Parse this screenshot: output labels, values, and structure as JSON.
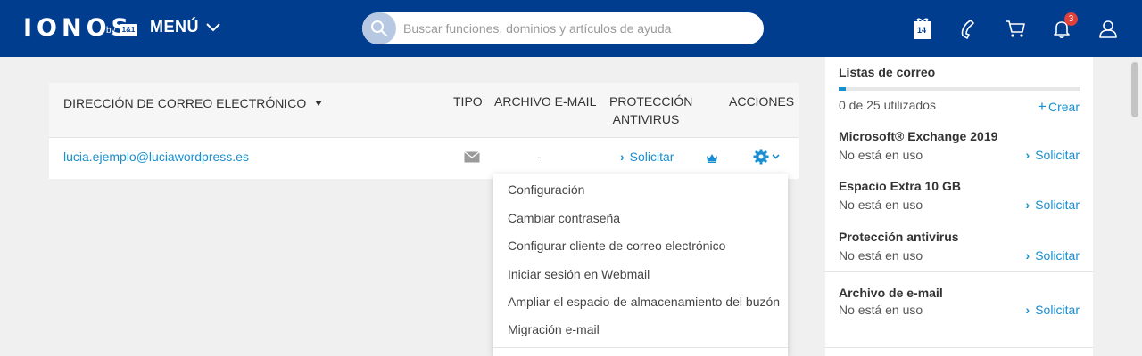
{
  "header": {
    "logo": "IONOS",
    "logo_by": "by",
    "logo_badge": "1&1",
    "menu_label": "MENÚ",
    "search_placeholder": "Buscar funciones, dominios y artículos de ayuda",
    "gift_number": "14",
    "notifications_count": "3",
    "icons": [
      "gift-icon",
      "phone-icon",
      "cart-icon",
      "bell-icon",
      "user-icon"
    ]
  },
  "table": {
    "columns": {
      "email": "DIRECCIÓN DE CORREO ELECTRÓNICO",
      "tipo": "TIPO",
      "archivo": "ARCHIVO E-MAIL",
      "proteccion_1": "PROTECCIÓN",
      "proteccion_2": "ANTIVIRUS",
      "acciones": "ACCIONES"
    },
    "rows": [
      {
        "email": "lucia.ejemplo@luciawordpress.es",
        "archivo": "-",
        "proteccion": "Solicitar"
      }
    ]
  },
  "actions_menu": [
    "Configuración",
    "Cambiar contraseña",
    "Configurar cliente de correo electrónico",
    "Iniciar sesión en Webmail",
    "Ampliar el espacio de almacenamiento del buzón",
    "Migración e-mail"
  ],
  "panel": {
    "mailing_lists": {
      "title": "Listas de correo",
      "usage": "0 de 25 utilizados",
      "usage_fraction": 0.03,
      "create": "Crear"
    },
    "products": [
      {
        "title": "Microsoft® Exchange 2019",
        "status": "No está en uso",
        "action": "Solicitar"
      },
      {
        "title": "Espacio Extra 10 GB",
        "status": "No está en uso",
        "action": "Solicitar"
      },
      {
        "title": "Protección antivirus",
        "status": "No está en uso",
        "action": "Solicitar"
      },
      {
        "title": "Archivo de e-mail",
        "status": "No está en uso",
        "action": "Solicitar"
      }
    ]
  },
  "colors": {
    "header_bg": "#003d8f",
    "link": "#1a8fd0",
    "badge": "#e0413a"
  }
}
